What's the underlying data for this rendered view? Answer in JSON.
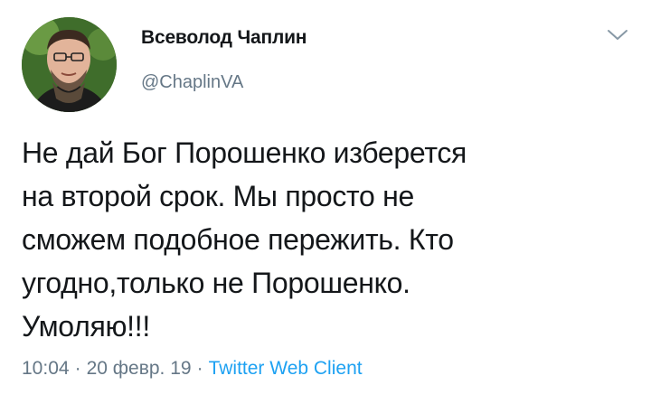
{
  "author": {
    "display_name": "Всеволод Чаплин",
    "handle": "@ChaplinVA"
  },
  "tweet": {
    "text_lines": [
      "Не дай Бог Порошенко изберется",
      "на второй срок. Мы просто не",
      "сможем подобное пережить. Кто",
      "угодно,только не Порошенко.",
      "Умоляю!!!"
    ],
    "time": "10:04",
    "date": "20 февр. 19",
    "separator": "·",
    "client": "Twitter Web Client"
  },
  "icons": {
    "menu": "chevron-down-icon",
    "avatar": "profile-photo"
  },
  "colors": {
    "text": "#14171a",
    "secondary": "#657786",
    "link": "#1da1f2"
  }
}
